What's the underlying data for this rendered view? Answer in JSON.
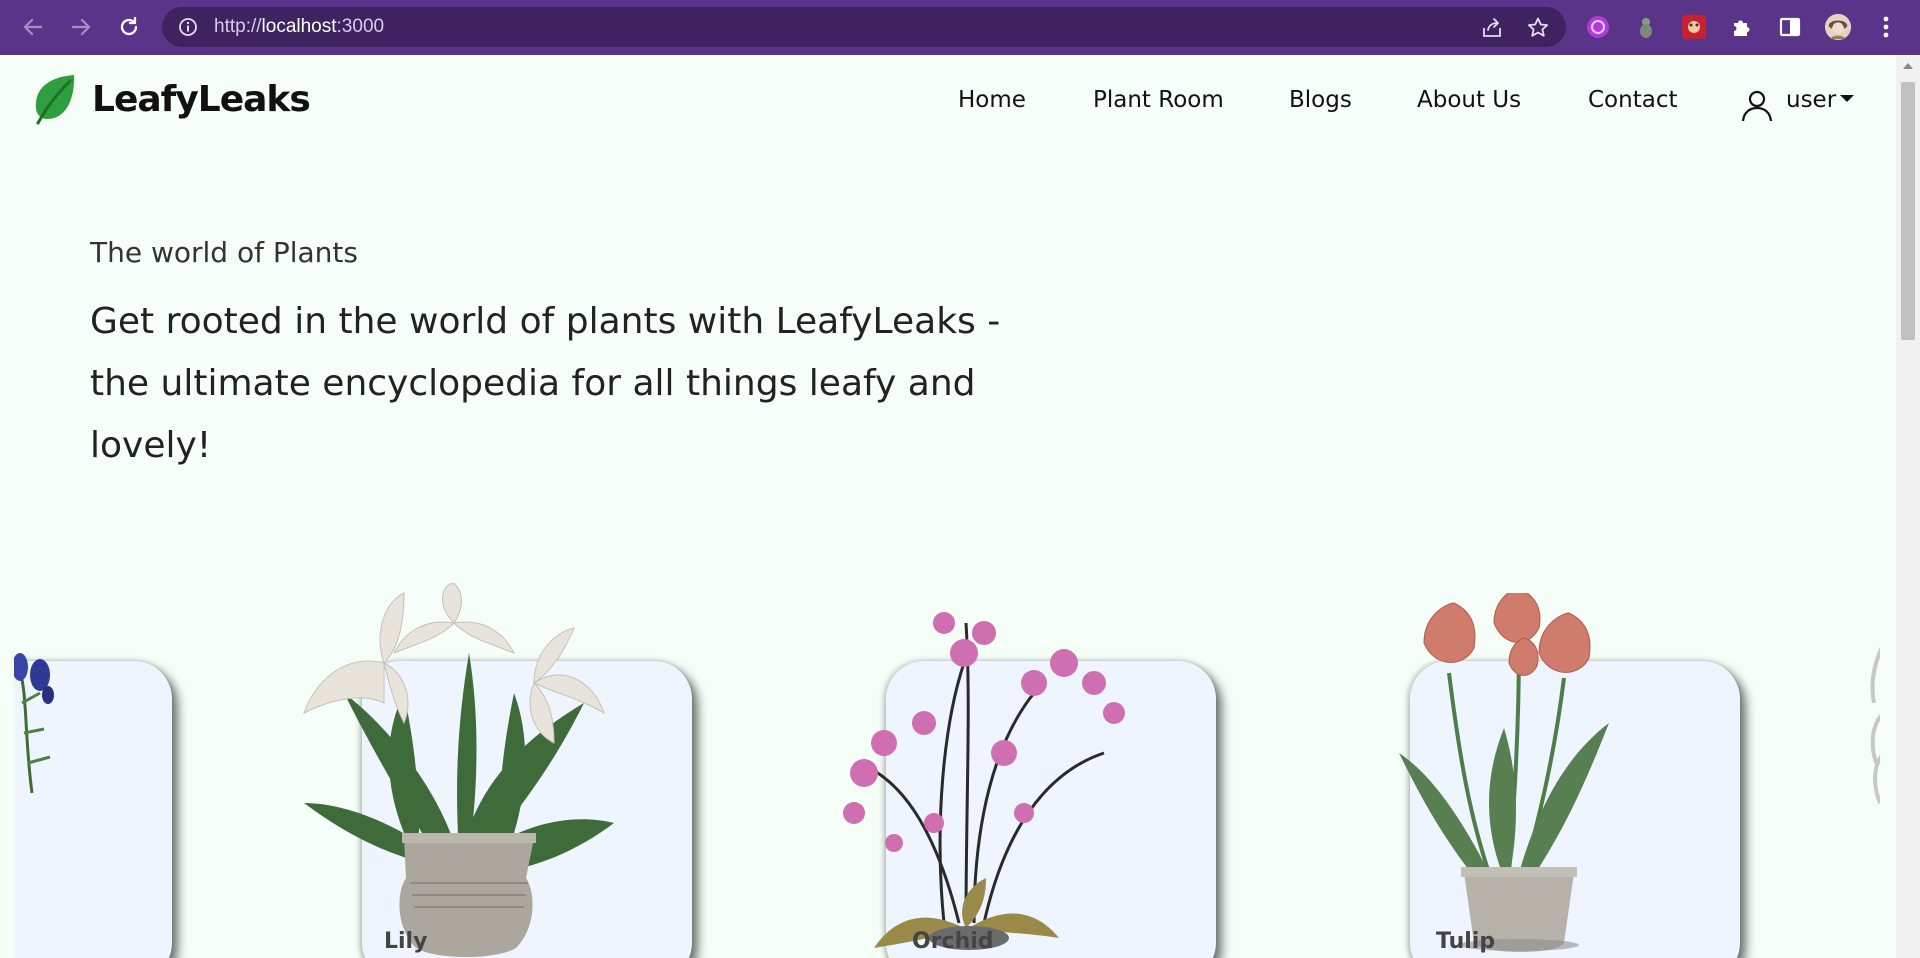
{
  "browser": {
    "url_scheme": "http://",
    "url_host": "localhost",
    "url_port": ":3000"
  },
  "navbar": {
    "brand": "LeafyLeaks",
    "links": [
      "Home",
      "Plant Room",
      "Blogs",
      "About Us",
      "Contact"
    ],
    "user_label": "user"
  },
  "hero": {
    "subtitle": "The world of Plants",
    "title": "Get rooted in the world of plants with LeafyLeaks - the ultimate encyclopedia for all things leafy and lovely!"
  },
  "carousel": {
    "cards": [
      "Lily",
      "Orchid",
      "Tulip"
    ]
  },
  "colors": {
    "browser_bar": "#5a3488",
    "omnibox": "#3f2360",
    "page_bg": "#f5fff7",
    "card_bg": "#eef5ff",
    "logo_leaf": "#2e9e3e"
  }
}
